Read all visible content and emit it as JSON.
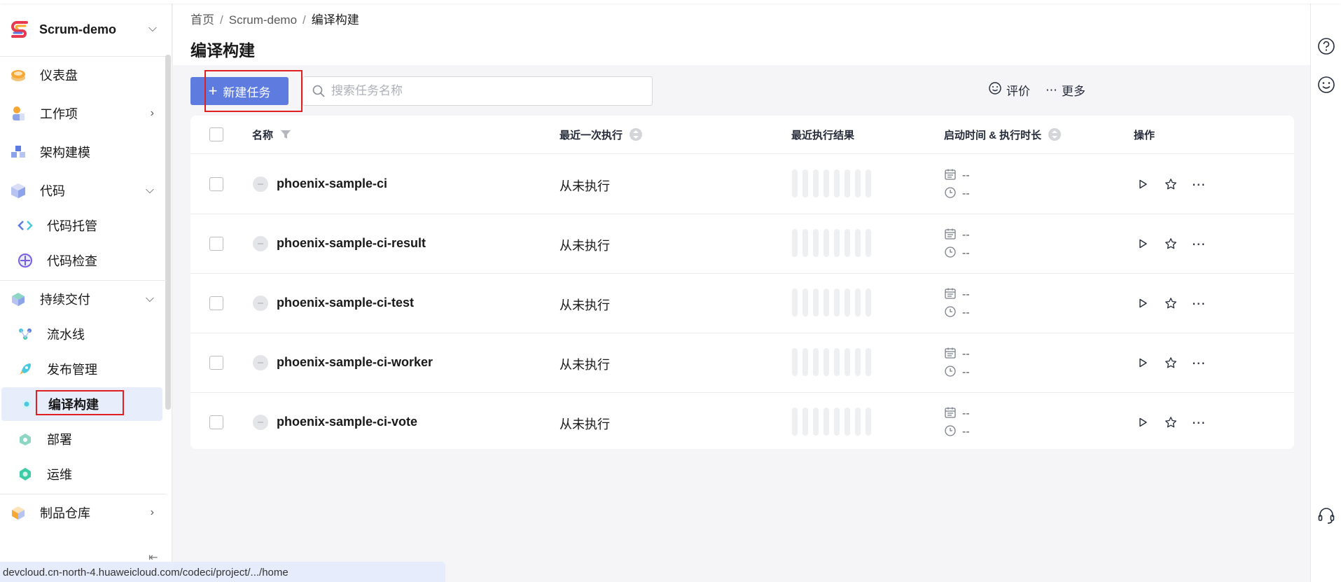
{
  "project": {
    "name": "Scrum-demo"
  },
  "sidebar": {
    "items": [
      {
        "label": "仪表盘",
        "icon": "dashboard-icon"
      },
      {
        "label": "工作项",
        "icon": "workitem-icon"
      },
      {
        "label": "架构建模",
        "icon": "architecture-icon"
      },
      {
        "label": "代码",
        "icon": "code-icon"
      },
      {
        "label": "代码托管",
        "icon": "code-hosting-icon"
      },
      {
        "label": "代码检查",
        "icon": "code-check-icon"
      },
      {
        "label": "持续交付",
        "icon": "delivery-icon"
      },
      {
        "label": "流水线",
        "icon": "pipeline-icon"
      },
      {
        "label": "发布管理",
        "icon": "release-icon"
      },
      {
        "label": "编译构建",
        "icon": "build-icon"
      },
      {
        "label": "部署",
        "icon": "deploy-icon"
      },
      {
        "label": "运维",
        "icon": "ops-icon"
      },
      {
        "label": "制品仓库",
        "icon": "artifact-icon"
      }
    ]
  },
  "breadcrumb": {
    "home": "首页",
    "project": "Scrum-demo",
    "current": "编译构建"
  },
  "page": {
    "title": "编译构建"
  },
  "toolbar": {
    "new_task": "新建任务",
    "search_placeholder": "搜索任务名称",
    "rate": "评价",
    "more": "更多"
  },
  "table": {
    "headers": {
      "name": "名称",
      "last_run": "最近一次执行",
      "last_result": "最近执行结果",
      "start_duration": "启动时间 & 执行时长",
      "actions": "操作"
    },
    "rows": [
      {
        "name": "phoenix-sample-ci",
        "last_run": "从未执行",
        "start_time": "--",
        "duration": "--"
      },
      {
        "name": "phoenix-sample-ci-result",
        "last_run": "从未执行",
        "start_time": "--",
        "duration": "--"
      },
      {
        "name": "phoenix-sample-ci-test",
        "last_run": "从未执行",
        "start_time": "--",
        "duration": "--"
      },
      {
        "name": "phoenix-sample-ci-worker",
        "last_run": "从未执行",
        "start_time": "--",
        "duration": "--"
      },
      {
        "name": "phoenix-sample-ci-vote",
        "last_run": "从未执行",
        "start_time": "--",
        "duration": "--"
      }
    ]
  },
  "status_url": "devcloud.cn-north-4.huaweicloud.com/codeci/project/.../home",
  "colors": {
    "primary": "#5e7ce0",
    "highlight": "#e02020",
    "active_bg": "#e8edfc"
  }
}
